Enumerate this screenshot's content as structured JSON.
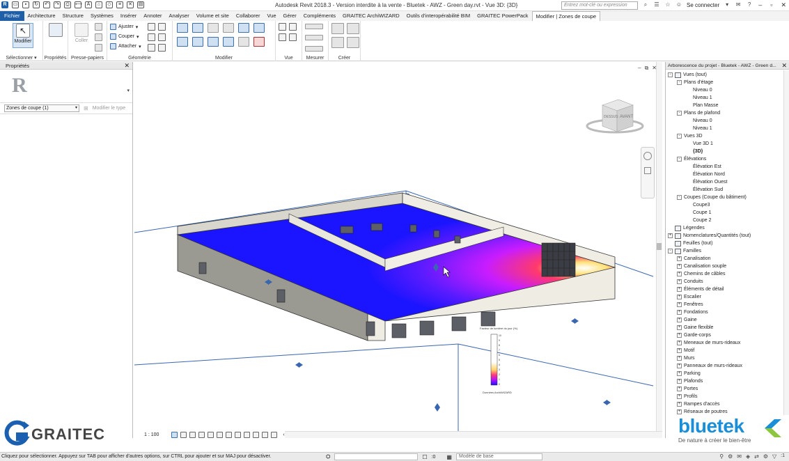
{
  "titlebar": {
    "title": "Autodesk Revit 2018.3 - Version interdite à la vente -    Bluetek - AWZ - Green day.rvt - Vue 3D: {3D}",
    "search_placeholder": "Entrez mot-clé ou expression",
    "signin": "Se connecter"
  },
  "menu": {
    "tabs": [
      "Fichier",
      "Architecture",
      "Structure",
      "Systèmes",
      "Insérer",
      "Annoter",
      "Analyser",
      "Volume et site",
      "Collaborer",
      "Vue",
      "Gérer",
      "Compléments",
      "GRAITEC ArchiWIZARD",
      "Outils d'interopérabilité BIM",
      "GRAITEC PowerPack",
      "Modifier | Zones de coupe"
    ]
  },
  "ribbon": {
    "modifier": "Modifier",
    "selectionner": "Sélectionner ▾",
    "proprietes": "Propriétés",
    "coller": "Coller",
    "presse_papiers": "Presse-papiers",
    "ajuster": "Ajuster",
    "couper": "Couper",
    "attacher": "Attacher",
    "geometrie": "Géométrie",
    "modifier_panel": "Modifier",
    "vue": "Vue",
    "mesurer": "Mesurer",
    "creer": "Créer"
  },
  "properties": {
    "title": "Propriétés",
    "type_selector": "Zones de coupe (1)",
    "edit_type": "Modifier le type"
  },
  "viewport": {
    "scale": "1 : 100",
    "viewcube_face_top": "DESSUS",
    "viewcube_face_front": "AVANT",
    "legend_title": "Facteur de lumière du jour (%)",
    "legend_footer": "Données ArchiWIZARD",
    "legend_ticks": [
      "10",
      "9",
      "8",
      "7",
      "6",
      "5",
      "4",
      "3",
      "2",
      "1",
      "0"
    ]
  },
  "browser": {
    "title": "Arborescence du projet - Bluetek - AWZ - Green d...",
    "tree": [
      {
        "label": "Vues (tout)",
        "level": 0,
        "tog": "-",
        "icon": true
      },
      {
        "label": "Plans d'étage",
        "level": 1,
        "tog": "-"
      },
      {
        "label": "Niveau 0",
        "level": 2
      },
      {
        "label": "Niveau 1",
        "level": 2
      },
      {
        "label": "Plan Masse",
        "level": 2
      },
      {
        "label": "Plans de plafond",
        "level": 1,
        "tog": "-"
      },
      {
        "label": "Niveau 0",
        "level": 2
      },
      {
        "label": "Niveau 1",
        "level": 2
      },
      {
        "label": "Vues 3D",
        "level": 1,
        "tog": "-"
      },
      {
        "label": "Vue 3D 1",
        "level": 2
      },
      {
        "label": "{3D}",
        "level": 2,
        "bold": true
      },
      {
        "label": "Élévations",
        "level": 1,
        "tog": "-"
      },
      {
        "label": "Élévation Est",
        "level": 2
      },
      {
        "label": "Élévation Nord",
        "level": 2
      },
      {
        "label": "Élévation Ouest",
        "level": 2
      },
      {
        "label": "Élévation Sud",
        "level": 2
      },
      {
        "label": "Coupes (Coupe du bâtiment)",
        "level": 1,
        "tog": "-"
      },
      {
        "label": "Coupe3",
        "level": 2
      },
      {
        "label": "Coupe 1",
        "level": 2
      },
      {
        "label": "Coupe 2",
        "level": 2
      },
      {
        "label": "Légendes",
        "level": 0,
        "icon": true
      },
      {
        "label": "Nomenclatures/Quantités (tout)",
        "level": 0,
        "tog": "+",
        "icon": true
      },
      {
        "label": "Feuilles (tout)",
        "level": 0,
        "icon": true
      },
      {
        "label": "Familles",
        "level": 0,
        "tog": "-",
        "icon": true
      },
      {
        "label": "Canalisation",
        "level": 1,
        "tog": "+"
      },
      {
        "label": "Canalisation souple",
        "level": 1,
        "tog": "+"
      },
      {
        "label": "Chemins de câbles",
        "level": 1,
        "tog": "+"
      },
      {
        "label": "Conduits",
        "level": 1,
        "tog": "+"
      },
      {
        "label": "Éléments de détail",
        "level": 1,
        "tog": "+"
      },
      {
        "label": "Escalier",
        "level": 1,
        "tog": "+"
      },
      {
        "label": "Fenêtres",
        "level": 1,
        "tog": "+"
      },
      {
        "label": "Fondations",
        "level": 1,
        "tog": "+"
      },
      {
        "label": "Gaine",
        "level": 1,
        "tog": "+"
      },
      {
        "label": "Gaine flexible",
        "level": 1,
        "tog": "+"
      },
      {
        "label": "Garde-corps",
        "level": 1,
        "tog": "+"
      },
      {
        "label": "Meneaux de murs-rideaux",
        "level": 1,
        "tog": "+"
      },
      {
        "label": "Motif",
        "level": 1,
        "tog": "+"
      },
      {
        "label": "Murs",
        "level": 1,
        "tog": "+"
      },
      {
        "label": "Panneaux de murs-rideaux",
        "level": 1,
        "tog": "+"
      },
      {
        "label": "Parking",
        "level": 1,
        "tog": "+"
      },
      {
        "label": "Plafonds",
        "level": 1,
        "tog": "+"
      },
      {
        "label": "Portes",
        "level": 1,
        "tog": "+"
      },
      {
        "label": "Profils",
        "level": 1,
        "tog": "+"
      },
      {
        "label": "Rampes d'accès",
        "level": 1,
        "tog": "+"
      },
      {
        "label": "Réseaux de poutres",
        "level": 1,
        "tog": "+"
      }
    ]
  },
  "status": {
    "text": "Cliquez pour sélectionner. Appuyez sur TAB pour afficher d'autres options, sur CTRL pour ajouter et sur MAJ pour désactiver.",
    "zero": ":0",
    "model": "Modèle de base",
    "filter": ":1"
  },
  "logos": {
    "graitec": "GRAITEC",
    "bluetek": "bluetek",
    "bluetek_tagline": "De nature à créer le bien-être"
  },
  "colors": {
    "revit_blue": "#1f5fa8",
    "bluetek_blue": "#1b8ed8"
  }
}
